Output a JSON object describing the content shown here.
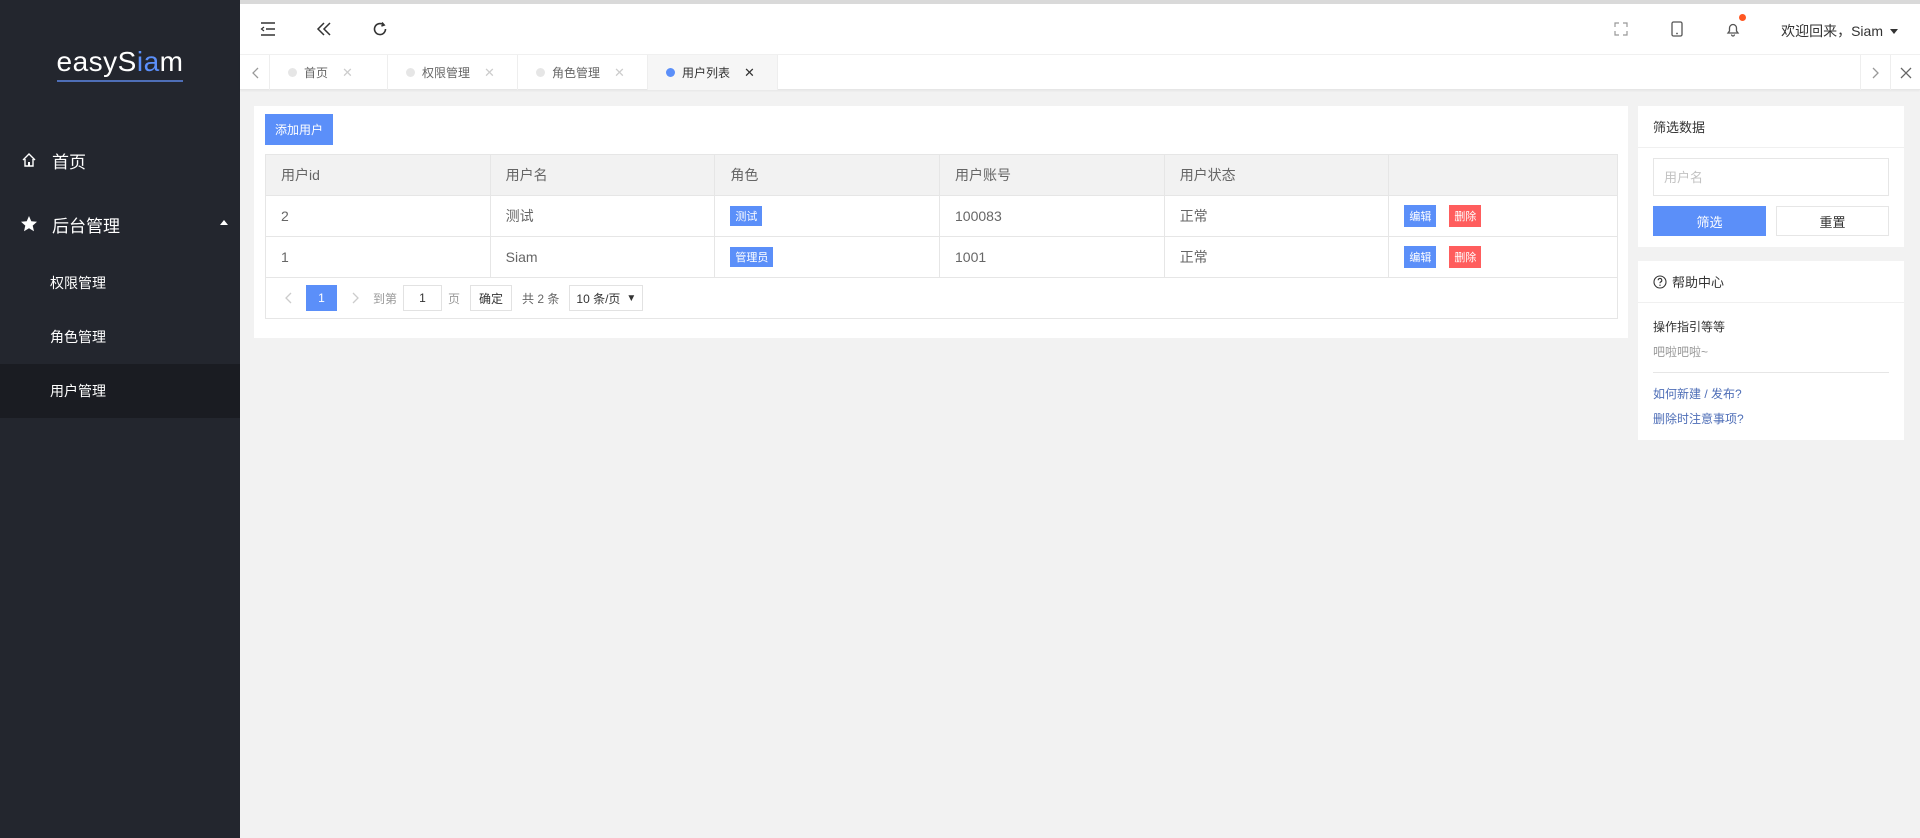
{
  "app": {
    "logo_prefix": "easyS",
    "logo_accent": "ia",
    "logo_suffix": "m"
  },
  "sidebar": {
    "items": [
      {
        "label": "首页",
        "icon": "home-icon"
      },
      {
        "label": "后台管理",
        "icon": "star-icon",
        "expanded": true
      }
    ],
    "sub_items": [
      {
        "label": "权限管理"
      },
      {
        "label": "角色管理"
      },
      {
        "label": "用户管理",
        "active": true
      }
    ]
  },
  "header": {
    "icons": [
      "menu-fold-icon",
      "double-chevron-left-icon",
      "refresh-icon",
      "fullscreen-icon",
      "mobile-icon",
      "bell-icon"
    ],
    "welcome": "欢迎回来，Siam"
  },
  "tabs": [
    {
      "label": "首页",
      "active": false
    },
    {
      "label": "权限管理",
      "active": false
    },
    {
      "label": "角色管理",
      "active": false
    },
    {
      "label": "用户列表",
      "active": true
    }
  ],
  "main": {
    "add_button": "添加用户",
    "table": {
      "columns": [
        "用户id",
        "用户名",
        "角色",
        "用户账号",
        "用户状态",
        ""
      ],
      "rows": [
        {
          "id": "2",
          "username": "测试",
          "role": "测试",
          "account": "100083",
          "status": "正常"
        },
        {
          "id": "1",
          "username": "Siam",
          "role": "管理员",
          "account": "1001",
          "status": "正常"
        }
      ],
      "edit_label": "编辑",
      "delete_label": "删除"
    },
    "pager": {
      "current_page": "1",
      "goto_label": "到第",
      "page_value": "1",
      "page_unit": "页",
      "confirm": "确定",
      "total": "共 2 条",
      "page_size": "10 条/页"
    }
  },
  "filter_panel": {
    "title": "筛选数据",
    "username_placeholder": "用户名",
    "filter_button": "筛选",
    "reset_button": "重置"
  },
  "help_panel": {
    "title": "帮助中心",
    "subtitle": "操作指引等等",
    "desc": "吧啦吧啦~",
    "links": [
      "如何新建 / 发布?",
      "删除时注意事项?"
    ]
  },
  "colors": {
    "sidebar_bg": "#23262e",
    "accent": "#5b8ff9",
    "danger": "#ff5d5d"
  }
}
